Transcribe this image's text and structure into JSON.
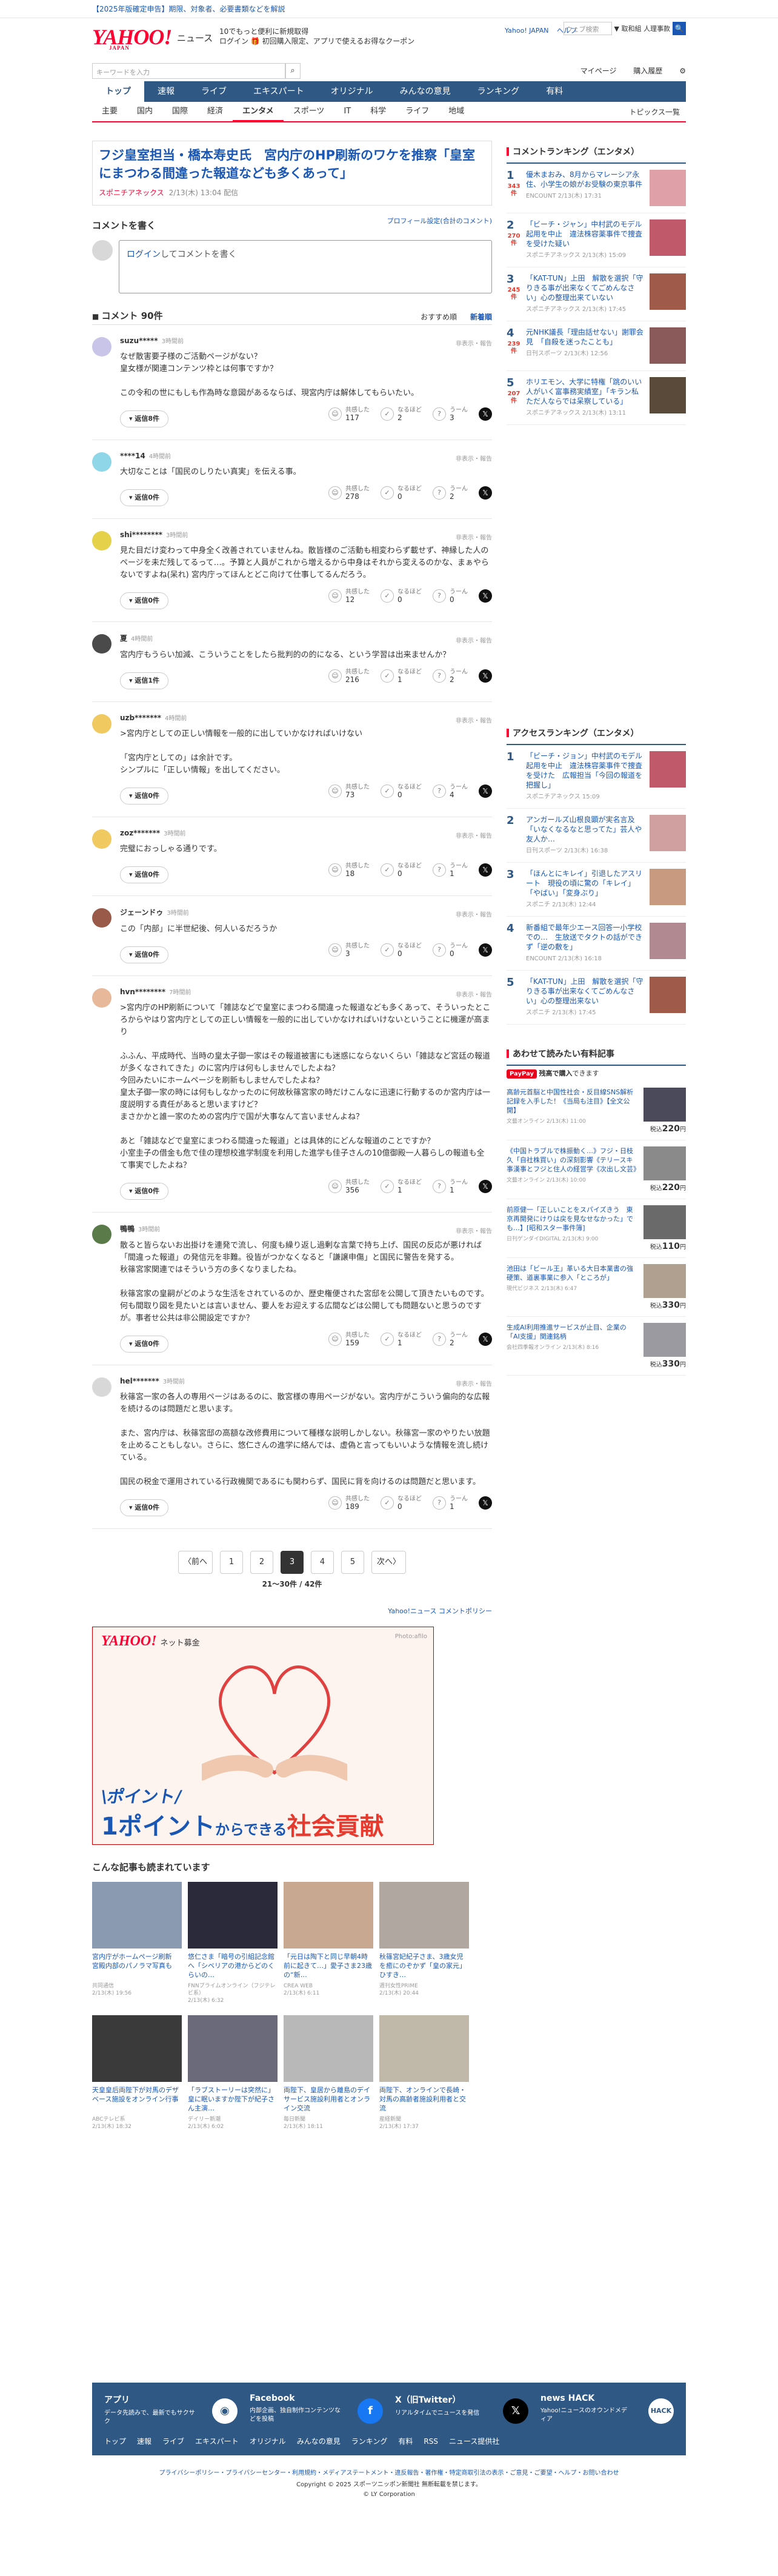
{
  "topbar": {
    "banner": "【2025年版確定申告】期限、対象者、必要書類などを解説"
  },
  "header": {
    "logo": "YAHOO!",
    "logo_sub": "JAPAN",
    "section_name": "ニュース",
    "promo_line1": "10でもっと便利に新規取得",
    "promo_line2": "ログイン 🎁 初回購入限定、アプリで使えるお得なクーポン",
    "links": [
      "Yahoo! JAPAN",
      "ヘルプ"
    ],
    "search_placeholder": "ウェブ検索",
    "search_scope": "▼ 取和組 人理事款",
    "search_btn": "🔍"
  },
  "searchbar": {
    "placeholder": "キーワードを入力",
    "right": [
      "マイページ",
      "購入履歴",
      "⚙"
    ]
  },
  "nav_main": [
    {
      "label": "トップ",
      "active": true
    },
    {
      "label": "速報"
    },
    {
      "label": "ライブ"
    },
    {
      "label": "エキスパート"
    },
    {
      "label": "オリジナル"
    },
    {
      "label": "みんなの意見"
    },
    {
      "label": "ランキング"
    },
    {
      "label": "有料"
    }
  ],
  "nav_sub": [
    {
      "label": "主要"
    },
    {
      "label": "国内"
    },
    {
      "label": "国際"
    },
    {
      "label": "経済"
    },
    {
      "label": "エンタメ",
      "active": true
    },
    {
      "label": "スポーツ"
    },
    {
      "label": "IT"
    },
    {
      "label": "科学"
    },
    {
      "label": "ライフ"
    },
    {
      "label": "地域"
    }
  ],
  "nav_sub_right": "トピックス一覧",
  "article": {
    "title": "フジ皇室担当・橋本寿史氏　宮内庁のHP刷新のワケを推察「皇室にまつわる間違った報道なども多くあって」",
    "source": "スポニチアネックス",
    "date": "2/13(木) 13:04 配信"
  },
  "comment_write": {
    "title": "コメントを書く",
    "profile_link": "プロフィール設定(合計のコメント)",
    "prompt_link": "ログイン",
    "prompt_rest": "してコメントを書く"
  },
  "comments_header": {
    "title": "コメント 90件",
    "tabs": [
      "おすすめ順",
      "新着順"
    ]
  },
  "vote_labels": {
    "agree": "共感した",
    "insight": "なるほど",
    "hmm": "うーん"
  },
  "hide_label": "非表示・報告",
  "comments": [
    {
      "user": "suzu*****",
      "time": "3時間前",
      "color": "#c9c5e8",
      "body": "なぜ散害要子様のご活動ページがない？\n皇女様が関連コンテンツ枠とは何事ですか？\n\nこの令和の世にもしも作為時な意図があるならば、現宮内庁は解体してもらいたい。",
      "reply": "返信8件",
      "agree": "117",
      "insight": "2",
      "hmm": "3"
    },
    {
      "user": "****14",
      "time": "4時間前",
      "color": "#8fd6e8",
      "body": "大切なことは「国民のしりたい真実」を伝える事。",
      "reply": "返信0件",
      "agree": "278",
      "insight": "0",
      "hmm": "2"
    },
    {
      "user": "shi********",
      "time": "3時間前",
      "color": "#e6d14a",
      "body": "見た目だけ変わって中身全く改善されていませんね。散皆様のご活動も相変わらず載せず、神縁した人のページを未だ残してるって…。予算と人員がこれから増えるから中身はそれから変えるのかな、まぁやらないですよね(呆れ) 宮内庁ってほんとどこ向けて仕事してるんだろう。",
      "reply": "返信0件",
      "agree": "12",
      "insight": "0",
      "hmm": "0"
    },
    {
      "user": "夏",
      "time": "4時間前",
      "color": "#4a4a4a",
      "body": "宮内庁もうらい加減、こういうことをしたら批判的の的になる、という学習は出来ませんか？",
      "reply": "返信1件",
      "agree": "216",
      "insight": "1",
      "hmm": "2"
    },
    {
      "user": "uzb*******",
      "time": "4時間前",
      "color": "#f0c960",
      "body": ">宮内庁としての正しい情報を一般的に出していかなければいけない\n\n「宮内庁としての」は余計です。\nシンプルに「正しい情報」を出してください。",
      "reply": "返信0件",
      "agree": "73",
      "insight": "0",
      "hmm": "4"
    },
    {
      "user": "zoz*******",
      "time": "3時間前",
      "color": "#f0c960",
      "body": "完璧におっしゃる通りです。",
      "reply": "返信0件",
      "agree": "18",
      "insight": "0",
      "hmm": "1"
    },
    {
      "user": "ジェーンドゥ",
      "time": "3時間前",
      "color": "#9a5a4a",
      "body": "この「内部」に半世紀後、何人いるだろうか",
      "reply": "返信0件",
      "agree": "3",
      "insight": "0",
      "hmm": "0"
    },
    {
      "user": "hvn********",
      "time": "7時間前",
      "color": "#e8b89a",
      "body": ">宮内庁のHP刷新について「雑誌などで皇室にまつわる間違った報道なども多くあって、そういったところからやはり宮内庁としての正しい情報を一般的に出していかなければいけないということに機運が高まり\n\nふふん、平成時代、当時の皇太子御一家はその報道被害にも迷惑にならないくらい「雑誌など宮廷の報道が多くなされてきた」のに宮内庁は何もしませんでしたよね？\n今回みたいにホームページを刷新もしませんでしたよね？\n皇太子御一家の時には何もしなかったのに何故秋篠宮家の時だけこんなに迅速に行動するのか宮内庁は一度説明する責任があると思いますけど？\nまさかかと誰一家のための宮内庁で国が大事なんて言いませんよね？\n\nあと「雑誌などで皇室にまつわる間違った報道」とは具体的にどんな報道のことですか？\n小室圭子の借金も危で佳の理想校進学制度を利用した進学も佳子さんの10億御殿一人暮らしの報道も全て事実でしたよね？",
      "reply": "返信0件",
      "agree": "356",
      "insight": "1",
      "hmm": "1"
    },
    {
      "user": "鴨鴨",
      "time": "3時間前",
      "color": "#5a7a4a",
      "body": "散ると皆らないお出掛けを連発で流し、何度も繰り返し過剰な言葉で持ち上げ、国民の反応が悪ければ「間違った報道」の発信元を非難。役皆がつかなくなると「謙譲申傷」と国民に警告を発する。\n秋篠宮家関連ではそういう方の多くなりましたね。\n\n秋篠宮家の皇嗣がどのような生活をされているのか、歴史権便された宮邸を公開して頂きたいものです。何も間取り図を見たいとは言いません、要人をお迎えする広間などは公開しても問題ないと思うのですが。事者せ公共は非公開設定ですか？",
      "reply": "返信0件",
      "agree": "159",
      "insight": "1",
      "hmm": "2"
    },
    {
      "user": "hel*******",
      "time": "3時間前",
      "color": "#d8d8d8",
      "body": "秋篠宮一家の各人の専用ページはあるのに、散宮様の専用ページがない。宮内庁がこういう偏向的な広報を続けるのは問題だと思います。\n\nまた、宮内庁は、秋篠宮邸の高額な改修費用について種様な説明しかしない。秋篠宮一家のやりたい放題を止めることもしない。さらに、悠仁さんの進学に絡んでは、虚偽と言ってもいいような情報を流し続けている。\n\n国民の税金で運用されている行政機関であるにも関わらず、国民に背を向けるのは問題だと思います。",
      "reply": "返信0件",
      "agree": "189",
      "insight": "0",
      "hmm": "1"
    }
  ],
  "pager": {
    "prev": "〈前へ",
    "pages": [
      "1",
      "2",
      "3",
      "4",
      "5"
    ],
    "current": "3",
    "next": "次へ〉",
    "count": "21〜30件 / 42件"
  },
  "policy_link": "Yahoo!ニュース コメントポリシー",
  "ad": {
    "logo": "YAHOO!",
    "logo_sub": "ネット募金",
    "photo_credit": "Photo:afilo",
    "line1": "\\ポイント/",
    "line2_a": "1ポイント",
    "line2_b": "からできる",
    "line2_c": "社会貢献"
  },
  "related": {
    "title": "こんな記事も読まれています",
    "items": [
      {
        "title": "宮内庁がホームページ刷新　宮殿内部のパノラマ写真も",
        "source": "共同通信",
        "date": "2/13(木) 19:56",
        "color": "#8a9ab0"
      },
      {
        "title": "悠仁さま「暗号の引組記念館へ「シベリアの港からどのくらいの…",
        "source": "FNNプライムオンライン（フジテレビ系）",
        "date": "2/13(木) 6:32",
        "color": "#2a2a3a"
      },
      {
        "title": "「元日は陶下と同じ早朝4時前に起きて…」愛子さま23歳の“新…",
        "source": "CREA WEB",
        "date": "2/13(木) 6:11",
        "color": "#c8a890"
      },
      {
        "title": "秋篠宮妃紀子さま、3歳女児を癒にのぞかず「皇の家元」ひすき…",
        "source": "週刊女性PRIME",
        "date": "2/13(木) 20:44",
        "color": "#b0a8a0"
      },
      {
        "title": "天皇皇后両陛下が対馬のデザベース施設をオンライン行事",
        "source": "ABCテレビ系",
        "date": "2/13(木) 18:32",
        "color": "#3a3a3a"
      },
      {
        "title": "「ラブストーリーは突然に」皇に眠いますか陛下が紀子さん主演…",
        "source": "デイリー新潮",
        "date": "2/13(木) 6:02",
        "color": "#6a6a7a"
      },
      {
        "title": "両陛下、皇居から離島のデイサービス施設利用者とオンライン交流",
        "source": "毎日新聞",
        "date": "2/13(木) 18:11",
        "color": "#b8b8b8"
      },
      {
        "title": "両陛下、オンラインで長崎・対馬の高齢者施設利用者と交流",
        "source": "産経新聞",
        "date": "2/13(木) 17:37",
        "color": "#c0b8a8"
      }
    ]
  },
  "side_comment_rank": {
    "title": "コメントランキング（エンタメ）",
    "items": [
      {
        "no": "1",
        "count": "343件",
        "title": "優木まおみ、8月からマレーシア永住、小学生の娘がお受験の東京事件",
        "source": "ENCOUNT 2/13(木) 17:31",
        "color": "#e0a0a8"
      },
      {
        "no": "2",
        "count": "270件",
        "title": "「ビーチ・ジャン」中村武のモデル起用を中止　違法株容薬事件で捜査を受けた疑い",
        "source": "スポニチアネックス 2/13(木) 15:09",
        "color": "#c05a6a"
      },
      {
        "no": "3",
        "count": "245件",
        "title": "「KAT-TUN」上田　解散を選択「守りきる事が出来なくてごめんなさい」心の整理出来ていない",
        "source": "スポニチアネックス 2/13(木) 17:45",
        "color": "#a05a4a"
      },
      {
        "no": "4",
        "count": "239件",
        "title": "元NHK議長「理由話せない」謝罪会見　「自殺を迷ったことも」",
        "source": "日刊スポーツ 2/13(木) 12:56",
        "color": "#8a5a5a"
      },
      {
        "no": "5",
        "count": "207件",
        "title": "ホリエモン、大学に特権「跳のいい人がいく富事務実績室」「キラン私ただ人ならでは呆察している」",
        "source": "スポニチアネックス 2/13(木) 13:11",
        "color": "#5a4a3a"
      }
    ]
  },
  "side_access_rank": {
    "title": "アクセスランキング（エンタメ）",
    "items": [
      {
        "no": "1",
        "title": "「ビーチ・ジョン」中村武のモデル起用を中止　違法株容薬事件で捜査を受けた　広報担当「今回の報道を把握し」",
        "source": "スポニチアネックス 15:09",
        "color": "#c05a6a"
      },
      {
        "no": "2",
        "title": "アンガールズ山根良顕が実名言及「いなくなるなと思ってた」芸人や友人か…",
        "source": "日刊スポーツ 2/13(木) 16:38",
        "color": "#d0a0a0"
      },
      {
        "no": "3",
        "title": "「ほんとにキレイ」引退したアスリート　現役の頃に驚の「キレイ」「やばい」「変身ぶり」",
        "source": "スポニチ 2/13(木) 12:44",
        "color": "#c89a80"
      },
      {
        "no": "4",
        "title": "新番組で最年少エース回答一小学校での…　生放送でタクトの話ができず「逆の敷を」",
        "source": "ENCOUNT 2/13(木) 16:18",
        "color": "#b08a90"
      },
      {
        "no": "5",
        "title": "「KAT-TUN」上田　解散を選択「守りきる事が出来なくてごめんなさい」心の整理出来ない",
        "source": "スポニチ 2/13(木) 17:45",
        "color": "#a05a4a"
      }
    ]
  },
  "side_paid": {
    "title": "あわせて読みたい有料記事",
    "paypay_badge": "PayPay",
    "paypay_text": "残高で購入",
    "paypay_tail": "できます",
    "items": [
      {
        "title": "高齢元首脳と中国性社会・反目線SNS解析記録を入手した！《当局も注目》【全文公開】",
        "source": "文藝オンライン 2/13(木) 11:00",
        "price": "220",
        "color": "#4a4a5a"
      },
      {
        "title": "《中国トラブルで株振動く…》フジ・日枝久「自社株買い」の深刻影響《テリースキ事漢事とフジと住人の経営学《次出し文芸》",
        "source": "文藝オンライン 2/13(木) 10:00",
        "price": "220",
        "color": "#8a8a8a"
      },
      {
        "title": "前原健一「正しいことをスパイズきう　東京再開発にけりは戻を見なせなかった」でも…】[昭和スター事件簿]",
        "source": "日刊ゲンダイDIGITAL 2/13(木) 9:00",
        "price": "110",
        "color": "#6a6a6a"
      },
      {
        "title": "池田は「ビール王」革いる大日本業書の強硬策、道裏事業に参入「ところが」",
        "source": "現代ビジネス 2/13(木) 6:47",
        "price": "330",
        "color": "#b0a090"
      },
      {
        "title": "生成AI利用推進サービスが止目、企業の「AI支援」関連銘柄",
        "source": "会社四季報オンライン 2/13(木) 8:16",
        "price": "330",
        "color": "#9a9aa0"
      }
    ]
  },
  "footer": {
    "app": {
      "title": "アプリ",
      "desc": "データ先読みで、最新でもサクサク"
    },
    "facebook": {
      "title": "Facebook",
      "desc": "内部企画、独自制作コンテンツなどを投稿"
    },
    "x": {
      "title": "X（旧Twitter）",
      "desc": "リアルタイムでニュースを発信"
    },
    "hack": {
      "title": "news HACK",
      "desc": "Yahoo!ニュースのオウンドメディア"
    },
    "nav": [
      "トップ",
      "速報",
      "ライブ",
      "エキスパート",
      "オリジナル",
      "みんなの意見",
      "ランキング",
      "有料",
      "RSS",
      "ニュース提供社"
    ],
    "links": "プライバシーポリシー・プライバシーセンター・利用規約・メディアステートメント・違反報告・著作権・特定商取引法の表示・ご意見・ご要望・ヘルプ・お問い合わせ",
    "copyright1": "Copyright © 2025 スポーツニッポン新聞社 無断転載を禁じます。",
    "copyright2": "© LY Corporation"
  }
}
